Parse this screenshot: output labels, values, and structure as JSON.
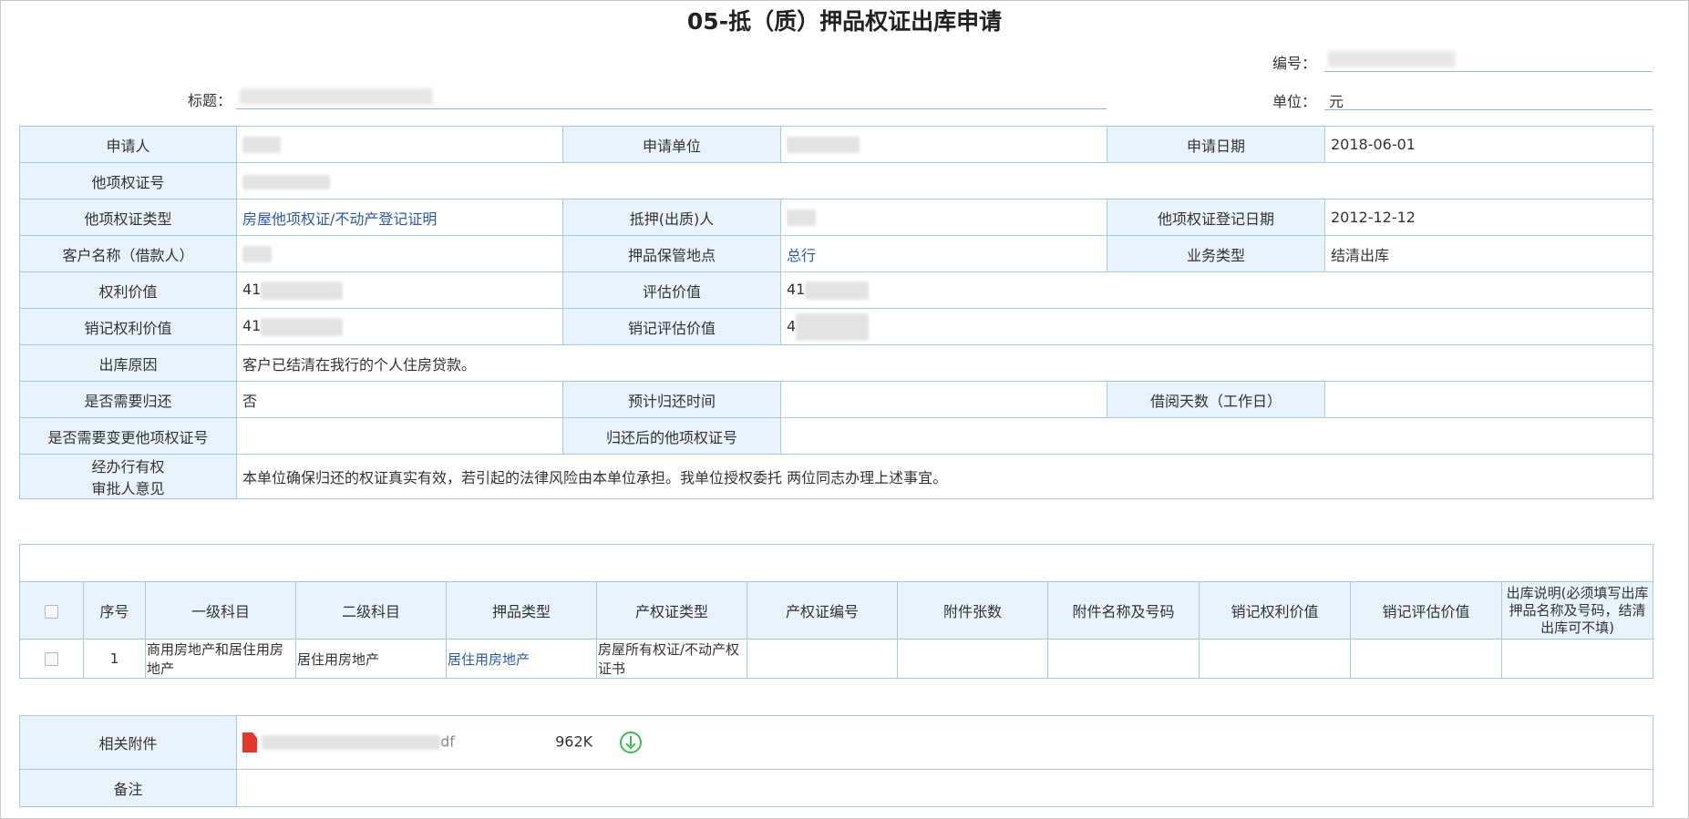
{
  "page": {
    "title": "05-抵（质）押品权证出库申请"
  },
  "header": {
    "number_label": "编号：",
    "title_label": "标题：",
    "unit_label": "单位：",
    "unit_value": "元"
  },
  "form": {
    "applicant_label": "申请人",
    "apply_unit_label": "申请单位",
    "apply_date_label": "申请日期",
    "apply_date_value": "2018-06-01",
    "cert_no_label": "他项权证号",
    "cert_type_label": "他项权证类型",
    "cert_type_value": "房屋他项权证/不动产登记证明",
    "mortgagor_label": "抵押(出质)人",
    "cert_reg_date_label": "他项权证登记日期",
    "cert_reg_date_value": "2012-12-12",
    "customer_label": "客户名称（借款人）",
    "storage_label": "押品保管地点",
    "storage_value": "总行",
    "biz_type_label": "业务类型",
    "biz_type_value": "结清出库",
    "right_value_label": "权利价值",
    "right_value_prefix": "41",
    "eval_value_label": "评估价值",
    "eval_value_prefix": "41",
    "cancel_right_label": "销记权利价值",
    "cancel_right_prefix": "41",
    "cancel_eval_label": "销记评估价值",
    "cancel_eval_prefix": "4",
    "reason_label": "出库原因",
    "reason_value": "客户已结清在我行的个人住房贷款。",
    "need_return_label": "是否需要归还",
    "need_return_value": "否",
    "expected_return_label": "预计归还时间",
    "borrow_days_label": "借阅天数（工作日）",
    "need_change_label": "是否需要变更他项权证号",
    "after_return_label": "归还后的他项权证号",
    "approver_label_1": "经办行有权",
    "approver_label_2": "审批人意见",
    "approver_value": "本单位确保归还的权证真实有效，若引起的法律风险由本单位承担。我单位授权委托  两位同志办理上述事宜。"
  },
  "items": {
    "columns": [
      "序号",
      "一级科目",
      "二级科目",
      "押品类型",
      "产权证类型",
      "产权证编号",
      "附件张数",
      "附件名称及号码",
      "销记权利价值",
      "销记评估价值",
      "出库说明(必须填写出库押品名称及号码，结清出库可不填)"
    ],
    "rows": [
      {
        "index": "1",
        "level1": "商用房地产和居住用房地产",
        "level2": "居住用房地产",
        "collateral_type": "居住用房地产",
        "cert_type": "房屋所有权证/不动产权证书",
        "cert_no": "",
        "attach_count": "",
        "attach_name": "",
        "cancel_right": "",
        "cancel_eval": "",
        "remark": ""
      }
    ]
  },
  "attachments": {
    "label": "相关附件",
    "file_suffix": "df",
    "file_size": "962K",
    "remark_label": "备注"
  },
  "colors": {
    "label_bg": "#e8f2fc",
    "border": "#a9c9e8",
    "link": "#2b5aa8",
    "download": "#3dbb52",
    "pdf": "#e03a2e"
  }
}
